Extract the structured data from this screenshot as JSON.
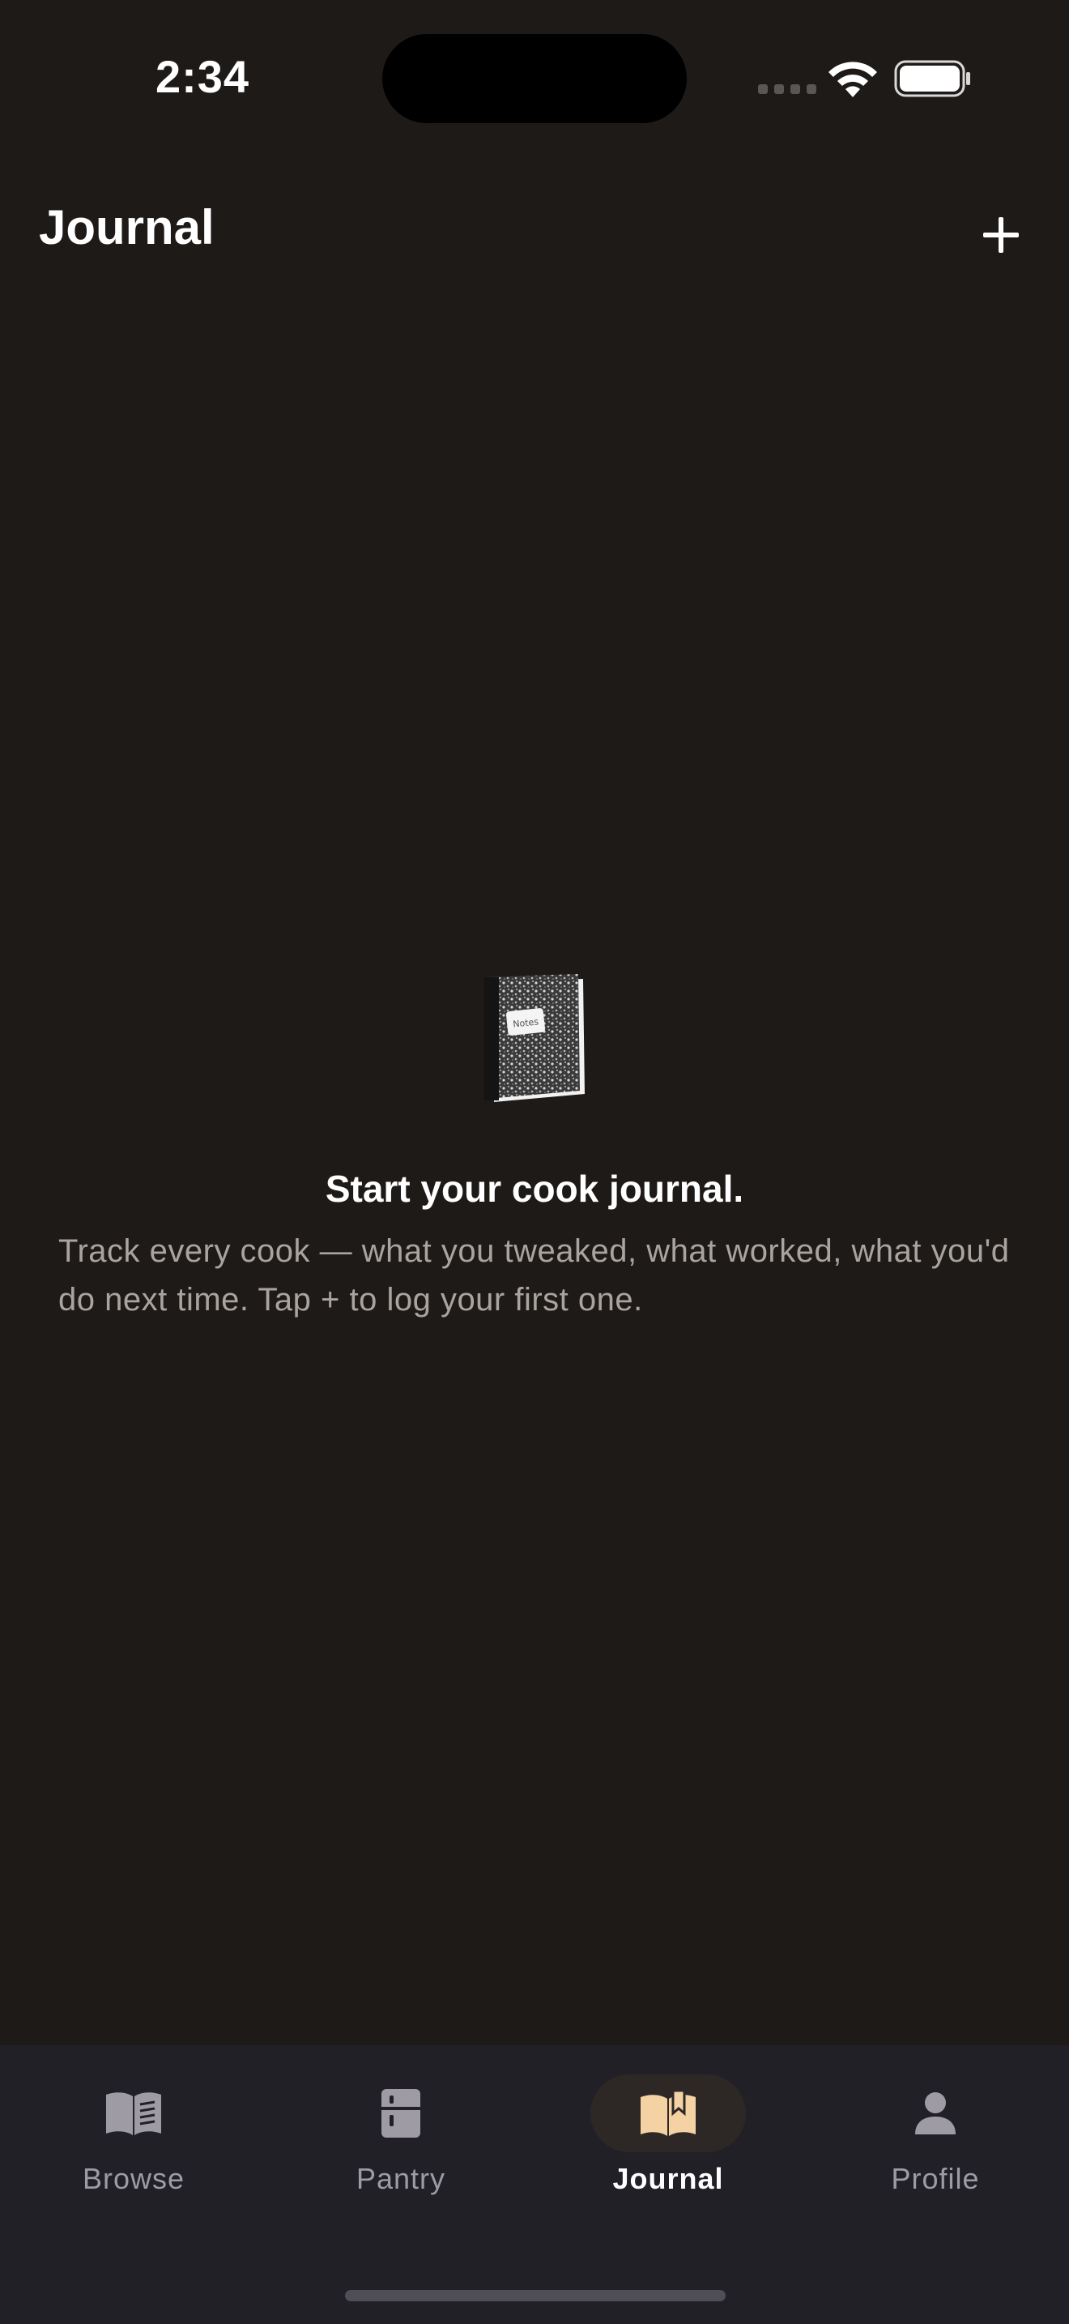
{
  "status_bar": {
    "time": "2:34"
  },
  "header": {
    "title": "Journal",
    "add_icon": "plus-icon"
  },
  "empty_state": {
    "icon": "notebook-icon",
    "notebook_label": "Notes",
    "title": "Start your cook journal.",
    "description": "Track every cook — what you tweaked, what worked, what you'd do next time. Tap + to log your first one."
  },
  "tabs": [
    {
      "label": "Browse",
      "icon": "open-book-icon",
      "active": false
    },
    {
      "label": "Pantry",
      "icon": "fridge-icon",
      "active": false
    },
    {
      "label": "Journal",
      "icon": "journal-icon",
      "active": true
    },
    {
      "label": "Profile",
      "icon": "person-icon",
      "active": false
    }
  ],
  "colors": {
    "background": "#1e1a18",
    "tab_bar": "#212027",
    "accent": "#f5d2a4",
    "inactive": "#9e9ba4"
  }
}
